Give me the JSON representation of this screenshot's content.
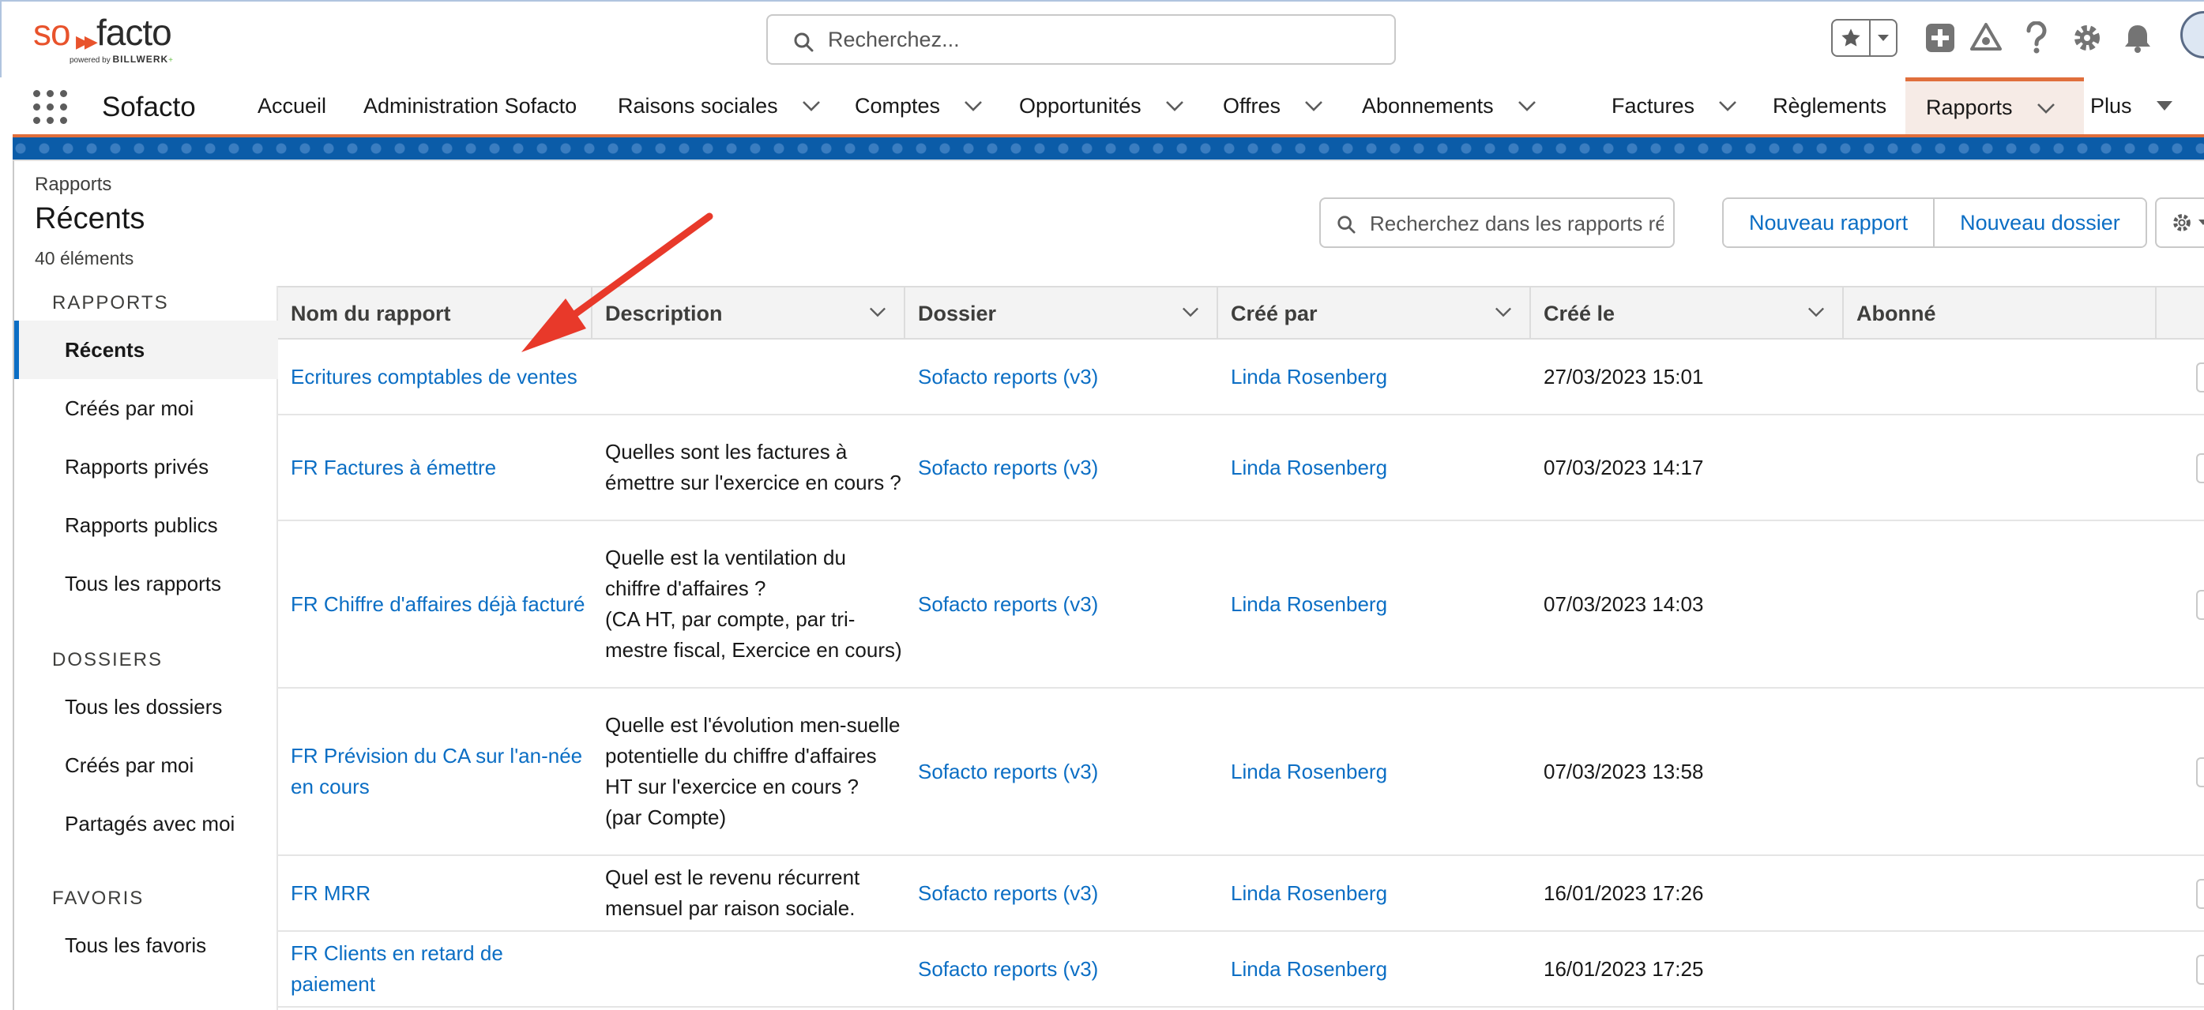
{
  "header": {
    "search_placeholder": "Recherchez...",
    "logo": {
      "so": "so",
      "facto": "facto",
      "powered_by": "powered by",
      "brand": "BILLWERK",
      "plus": "+"
    }
  },
  "nav": {
    "app_name": "Sofacto",
    "items": [
      {
        "label": "Accueil"
      },
      {
        "label": "Administration Sofacto"
      },
      {
        "label": "Raisons sociales"
      },
      {
        "label": "Comptes"
      },
      {
        "label": "Opportunités"
      },
      {
        "label": "Offres"
      },
      {
        "label": "Abonnements"
      },
      {
        "label": "Factures"
      },
      {
        "label": "Règlements"
      },
      {
        "label": "Rapports"
      },
      {
        "label": "Plus"
      }
    ]
  },
  "page": {
    "breadcrumb": "Rapports",
    "title": "Récents",
    "count": "40 éléments",
    "search_placeholder": "Recherchez dans les rapports réc",
    "new_report": "Nouveau rapport",
    "new_folder": "Nouveau dossier"
  },
  "sidebar": {
    "reports_heading": "RAPPORTS",
    "reports": [
      "Récents",
      "Créés par moi",
      "Rapports privés",
      "Rapports publics",
      "Tous les rapports"
    ],
    "folders_heading": "DOSSIERS",
    "folders": [
      "Tous les dossiers",
      "Créés par moi",
      "Partagés avec moi"
    ],
    "favorites_heading": "FAVORIS",
    "favorites": [
      "Tous les favoris"
    ]
  },
  "table": {
    "columns": [
      "Nom du rapport",
      "Description",
      "Dossier",
      "Créé par",
      "Créé le",
      "Abonné"
    ],
    "rows": [
      {
        "name": "Ecritures comptables de ventes",
        "description": "",
        "folder": "Sofacto reports (v3)",
        "created_by": "Linda Rosenberg",
        "created_on": "27/03/2023 15:01",
        "subscribed": ""
      },
      {
        "name": "FR Factures à émettre",
        "description": "Quelles sont les factures à émettre sur l'exercice en cours ?",
        "folder": "Sofacto reports (v3)",
        "created_by": "Linda Rosenberg",
        "created_on": "07/03/2023 14:17",
        "subscribed": ""
      },
      {
        "name": "FR Chiffre d'affaires déjà facturé",
        "description": "Quelle est la ventilation du chiffre d'affaires ?\n(CA HT, par compte, par tri-mestre fiscal, Exercice en cours)",
        "folder": "Sofacto reports (v3)",
        "created_by": "Linda Rosenberg",
        "created_on": "07/03/2023 14:03",
        "subscribed": ""
      },
      {
        "name": "FR Prévision du CA sur l'an-née en cours",
        "description": "Quelle est l'évolution men-suelle potentielle du chiffre d'affaires HT sur l'exercice en cours ?\n(par Compte)",
        "folder": "Sofacto reports (v3)",
        "created_by": "Linda Rosenberg",
        "created_on": "07/03/2023 13:58",
        "subscribed": ""
      },
      {
        "name": "FR MRR",
        "description": "Quel est le revenu récurrent mensuel par raison sociale.",
        "folder": "Sofacto reports (v3)",
        "created_by": "Linda Rosenberg",
        "created_on": "16/01/2023 17:26",
        "subscribed": ""
      },
      {
        "name": "FR Clients en retard de paiement",
        "description": "",
        "folder": "Sofacto reports (v3)",
        "created_by": "Linda Rosenberg",
        "created_on": "16/01/2023 17:25",
        "subscribed": ""
      }
    ]
  },
  "colors": {
    "brand_orange": "#e8532c",
    "link_blue": "#0b6ec4",
    "nav_accent": "#e06f3c",
    "banner": "#0b5ca8",
    "annotation_arrow": "#e8392a"
  }
}
